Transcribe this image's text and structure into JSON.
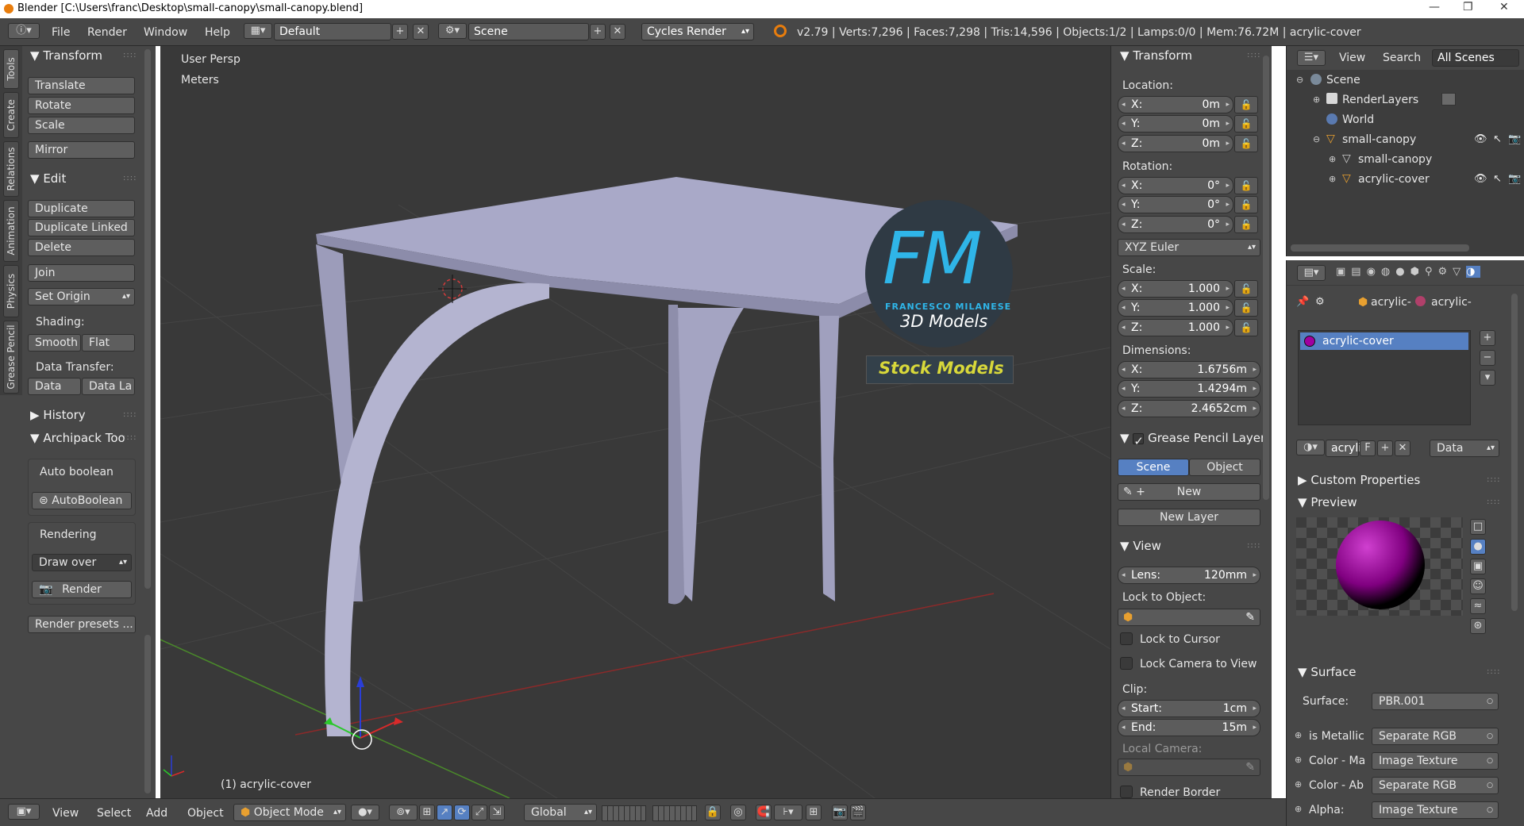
{
  "window": {
    "title": "Blender  [C:\\Users\\franc\\Desktop\\small-canopy\\small-canopy.blend]",
    "controls": [
      "—",
      "❐",
      "✕"
    ]
  },
  "header": {
    "menus": [
      "File",
      "Render",
      "Window",
      "Help"
    ],
    "layout": "Default",
    "scene": "Scene",
    "engine": "Cycles Render",
    "stats": "v2.79 | Verts:7,296 | Faces:7,298 | Tris:14,596 | Objects:1/2 | Lamps:0/0 | Mem:76.72M | acrylic-cover"
  },
  "toolshelf": {
    "tabs": [
      "Tools",
      "Create",
      "Relations",
      "Animation",
      "Physics",
      "Grease Pencil"
    ],
    "transform_title": "Transform",
    "transform_buttons": [
      "Translate",
      "Rotate",
      "Scale",
      "Mirror"
    ],
    "edit_title": "Edit",
    "edit_buttons": [
      "Duplicate",
      "Duplicate Linked",
      "Delete",
      "Join"
    ],
    "set_origin": "Set Origin",
    "shading_label": "Shading:",
    "smooth": "Smooth",
    "flat": "Flat",
    "data_transfer_label": "Data Transfer:",
    "data": "Data",
    "data_la": "Data La",
    "history_title": "History",
    "archipack_title": "Archipack Too",
    "auto_boolean_label": "Auto boolean",
    "auto_boolean_btn": "AutoBoolean",
    "rendering_label": "Rendering",
    "draw_over": "Draw over",
    "render_btn": "Render",
    "render_presets": "Render presets ..."
  },
  "viewport": {
    "view_name": "User Persp",
    "units": "Meters",
    "active_object": "(1) acrylic-cover",
    "watermark": {
      "letters": "FM",
      "author": "FRANCESCO MILANESE",
      "subtitle": "3D Models",
      "banner": "Stock Models"
    }
  },
  "npanel": {
    "transform_title": "Transform",
    "location_label": "Location:",
    "location": [
      {
        "k": "X:",
        "v": "0m"
      },
      {
        "k": "Y:",
        "v": "0m"
      },
      {
        "k": "Z:",
        "v": "0m"
      }
    ],
    "rotation_label": "Rotation:",
    "rotation": [
      {
        "k": "X:",
        "v": "0°"
      },
      {
        "k": "Y:",
        "v": "0°"
      },
      {
        "k": "Z:",
        "v": "0°"
      }
    ],
    "rotation_mode": "XYZ Euler",
    "scale_label": "Scale:",
    "scale": [
      {
        "k": "X:",
        "v": "1.000"
      },
      {
        "k": "Y:",
        "v": "1.000"
      },
      {
        "k": "Z:",
        "v": "1.000"
      }
    ],
    "dimensions_label": "Dimensions:",
    "dimensions": [
      {
        "k": "X:",
        "v": "1.6756m"
      },
      {
        "k": "Y:",
        "v": "1.4294m"
      },
      {
        "k": "Z:",
        "v": "2.4652cm"
      }
    ],
    "grease_title": "Grease Pencil Layer",
    "grease_scene": "Scene",
    "grease_object": "Object",
    "grease_new": "New",
    "grease_new_layer": "New Layer",
    "view_title": "View",
    "lens_label": "Lens:",
    "lens_value": "120mm",
    "lock_to_object": "Lock to Object:",
    "lock_to_cursor": "Lock to Cursor",
    "lock_camera": "Lock Camera to View",
    "clip_label": "Clip:",
    "clip_start_label": "Start:",
    "clip_start": "1cm",
    "clip_end_label": "End:",
    "clip_end": "15m",
    "local_camera": "Local Camera:",
    "render_border": "Render Border"
  },
  "outliner": {
    "view": "View",
    "search": "Search",
    "filter": "All Scenes",
    "items": [
      {
        "label": "Scene",
        "level": 0
      },
      {
        "label": "RenderLayers",
        "level": 1
      },
      {
        "label": "World",
        "level": 1
      },
      {
        "label": "small-canopy",
        "level": 1
      },
      {
        "label": "small-canopy",
        "level": 2
      },
      {
        "label": "acrylic-cover",
        "level": 2
      }
    ]
  },
  "properties": {
    "breadcrumb": [
      "acrylic-",
      "acrylic-"
    ],
    "material_slot": "acrylic-cover",
    "mat_name_short": "acryli",
    "mat_f": "F",
    "data_select": "Data",
    "custom_props_title": "Custom Properties",
    "preview_title": "Preview",
    "surface_title": "Surface",
    "surface_label": "Surface:",
    "surface_value": "PBR.001",
    "rows": [
      {
        "label": "is Metallic",
        "value": "Separate RGB"
      },
      {
        "label": "Color - Ma",
        "value": "Image Texture"
      },
      {
        "label": "Color - Ab",
        "value": "Separate RGB"
      },
      {
        "label": "Alpha:",
        "value": "Image Texture"
      }
    ]
  },
  "statusbar": {
    "menus": [
      "View",
      "Select",
      "Add",
      "Object"
    ],
    "mode": "Object Mode",
    "orientation": "Global"
  },
  "colors": {
    "panel": "#474747",
    "viewport": "#393939",
    "highlight": "#5680c2",
    "grid_red": "#8b2a2a",
    "grid_green": "#4a8a2a",
    "object": "#a9a9c8",
    "watermark_blue": "#2fb5e8",
    "watermark_banner": "#d8d83a"
  }
}
